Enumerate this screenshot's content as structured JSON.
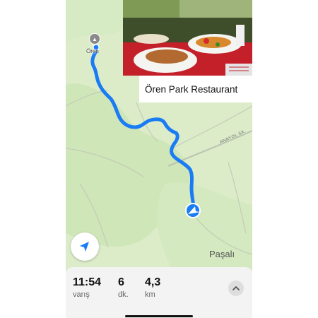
{
  "map": {
    "place_label": "Ören",
    "town_label": "Paşalı",
    "road_label": "ANAYOL SK.",
    "route_color": "#1a7cf5",
    "land_color": "#dcecc9"
  },
  "poi": {
    "name": "Ören Park Restaurant"
  },
  "route": {
    "arrival_time": "11:54",
    "arrival_label": "varış",
    "duration": "6",
    "duration_unit": "dk.",
    "distance": "4,3",
    "distance_unit": "km"
  },
  "icons": {
    "location": "location-arrow-icon",
    "expand": "chevron-up-icon",
    "pin": "mountain-pin-icon",
    "destination": "navigation-arrow-icon"
  }
}
